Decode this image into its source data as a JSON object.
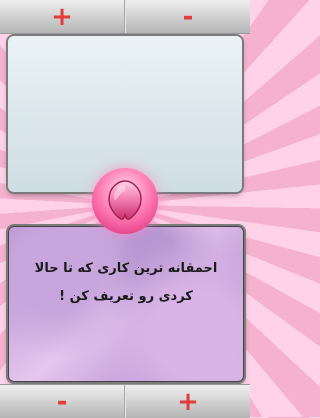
{
  "top_bar": {
    "left_label": "+",
    "right_label": "-"
  },
  "bottom_bar": {
    "left_label": "-",
    "right_label": "+"
  },
  "question": {
    "line1": "احمقانه ترین کاری که تا حالا",
    "line2": "کردی رو تعریف کن !"
  },
  "colors": {
    "red_symbol": "#e23c3c",
    "heart": "#f0579b",
    "background_rays": "#f7c2dc"
  },
  "icons": {
    "center": "heart-icon"
  }
}
